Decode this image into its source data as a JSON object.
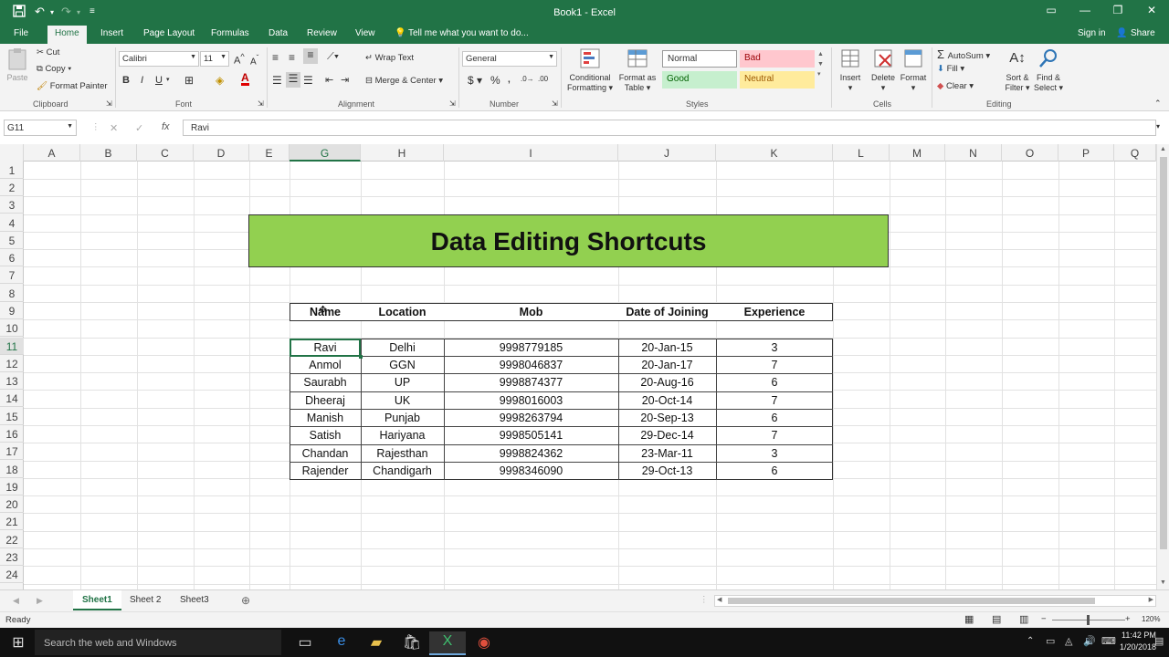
{
  "window": {
    "title": "Book1 - Excel"
  },
  "ribbon_tabs": [
    "File",
    "Home",
    "Insert",
    "Page Layout",
    "Formulas",
    "Data",
    "Review",
    "View"
  ],
  "tell_me": "Tell me what you want to do...",
  "account": {
    "signin": "Sign in",
    "share": "Share"
  },
  "clipboard": {
    "paste": "Paste",
    "cut": "Cut",
    "copy": "Copy",
    "format_painter": "Format Painter",
    "label": "Clipboard"
  },
  "font": {
    "name": "Calibri",
    "size": "11",
    "label": "Font",
    "bold": "B",
    "italic": "I",
    "underline": "U"
  },
  "alignment": {
    "wrap": "Wrap Text",
    "merge": "Merge & Center",
    "label": "Alignment"
  },
  "number": {
    "format": "General",
    "label": "Number",
    "currency": "$",
    "percent": "%"
  },
  "styles": {
    "conditional": "Conditional Formatting",
    "format_as_table": "Format as Table",
    "normal": "Normal",
    "bad": "Bad",
    "good": "Good",
    "neutral": "Neutral",
    "label": "Styles"
  },
  "cells": {
    "insert": "Insert",
    "delete": "Delete",
    "format": "Format",
    "label": "Cells"
  },
  "editing": {
    "autosum": "AutoSum",
    "fill": "Fill",
    "clear": "Clear",
    "sort": "Sort & Filter",
    "find": "Find & Select",
    "label": "Editing"
  },
  "formula_bar": {
    "name_box": "G11",
    "value": "Ravi",
    "fx": "fx"
  },
  "columns": [
    "A",
    "B",
    "C",
    "D",
    "E",
    "G",
    "H",
    "I",
    "J",
    "K",
    "L",
    "M",
    "N",
    "O",
    "P",
    "Q"
  ],
  "rows": [
    "1",
    "2",
    "3",
    "4",
    "5",
    "6",
    "7",
    "8",
    "9",
    "10",
    "11",
    "12",
    "13",
    "14",
    "15",
    "16",
    "17",
    "18",
    "19",
    "20",
    "21",
    "22",
    "23",
    "24"
  ],
  "banner": {
    "title": "Data Editing Shortcuts"
  },
  "table": {
    "headers": [
      "Name",
      "Location",
      "Mob",
      "Date of Joining",
      "Experience"
    ],
    "rows": [
      [
        "Ravi",
        "Delhi",
        "9998779185",
        "20-Jan-15",
        "3"
      ],
      [
        "Anmol",
        "GGN",
        "9998046837",
        "20-Jan-17",
        "7"
      ],
      [
        "Saurabh",
        "UP",
        "9998874377",
        "20-Aug-16",
        "6"
      ],
      [
        "Dheeraj",
        "UK",
        "9998016003",
        "20-Oct-14",
        "7"
      ],
      [
        "Manish",
        "Punjab",
        "9998263794",
        "20-Sep-13",
        "6"
      ],
      [
        "Satish",
        "Hariyana",
        "9998505141",
        "29-Dec-14",
        "7"
      ],
      [
        "Chandan",
        "Rajesthan",
        "9998824362",
        "23-Mar-11",
        "3"
      ],
      [
        "Rajender",
        "Chandigarh",
        "9998346090",
        "29-Oct-13",
        "6"
      ]
    ]
  },
  "sheets": [
    "Sheet1",
    "Sheet 2",
    "Sheet3"
  ],
  "status": {
    "ready": "Ready",
    "zoom": "120%"
  },
  "taskbar": {
    "search": "Search the web and Windows",
    "time": "11:42 PM",
    "date": "1/20/2018"
  },
  "colors": {
    "excel_green": "#217346",
    "banner_fill": "#92d050",
    "bad": "#ffc7ce",
    "good": "#c6efce",
    "neutral": "#ffeb9c"
  }
}
